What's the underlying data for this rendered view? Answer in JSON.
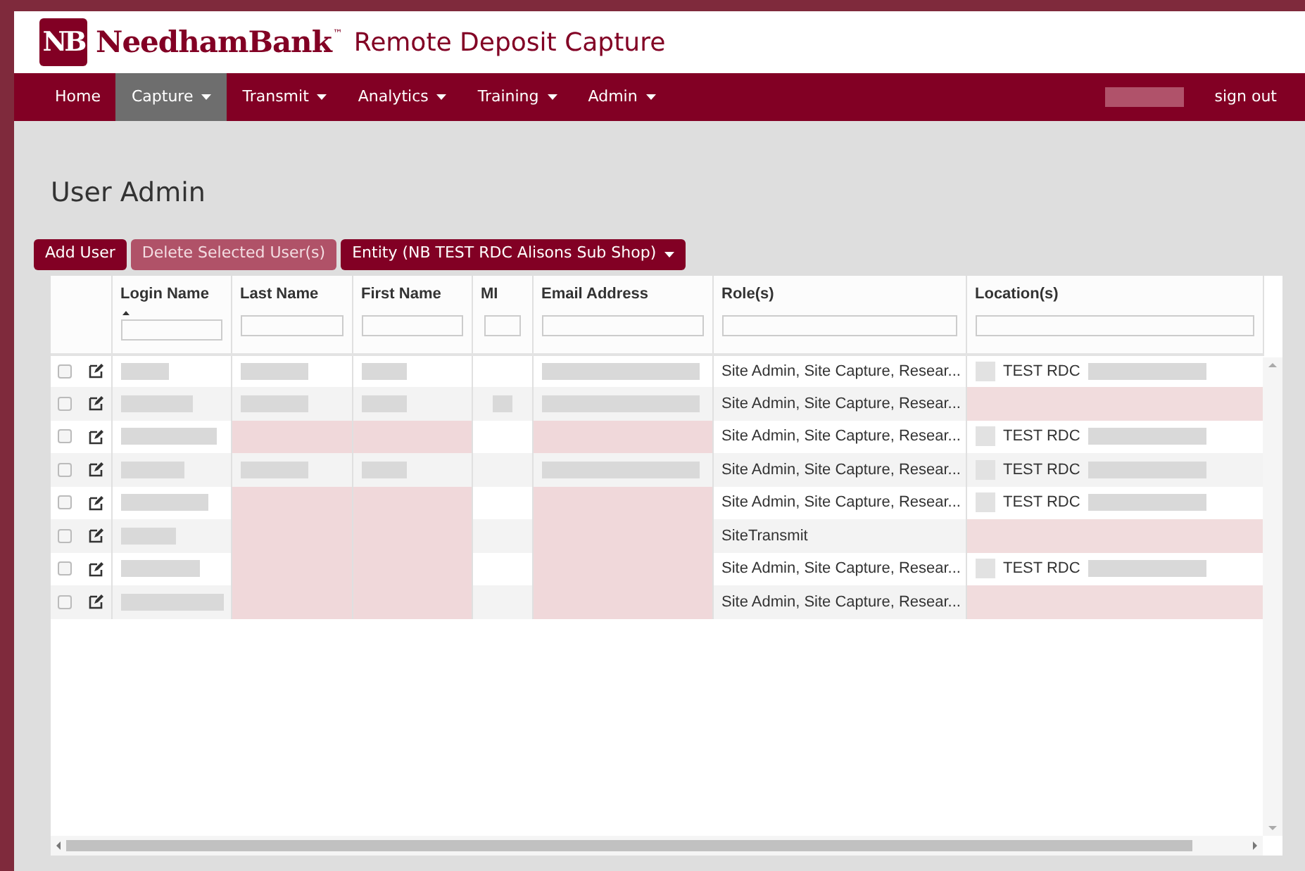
{
  "brand": {
    "mark": "NB",
    "name": "NeedhamBank",
    "trademark": "™",
    "product": "Remote Deposit Capture"
  },
  "nav": {
    "items": [
      {
        "label": "Home",
        "dropdown": false,
        "selected": false
      },
      {
        "label": "Capture",
        "dropdown": true,
        "selected": true
      },
      {
        "label": "Transmit",
        "dropdown": true,
        "selected": false
      },
      {
        "label": "Analytics",
        "dropdown": true,
        "selected": false
      },
      {
        "label": "Training",
        "dropdown": true,
        "selected": false
      },
      {
        "label": "Admin",
        "dropdown": true,
        "selected": false
      }
    ],
    "sign_out": "sign out"
  },
  "page_title": "User Admin",
  "toolbar": {
    "add": "Add User",
    "delete": {
      "label": "Delete Selected User(s)",
      "disabled": true
    },
    "entity": "Entity (NB TEST RDC Alisons Sub Shop)"
  },
  "table": {
    "columns": [
      {
        "label": "Login Name",
        "sorted": true
      },
      {
        "label": "Last Name",
        "sorted": false
      },
      {
        "label": "First Name",
        "sorted": false
      },
      {
        "label": "MI",
        "sorted": false
      },
      {
        "label": "Email Address",
        "sorted": false
      },
      {
        "label": "Role(s)",
        "sorted": false
      },
      {
        "label": "Location(s)",
        "sorted": false
      }
    ],
    "rows": [
      {
        "checked": false,
        "last_missing": false,
        "first_missing": false,
        "mi_filled": false,
        "email_missing": false,
        "roles": "Site Admin, Site Capture, Resear...",
        "location": "TEST RDC",
        "location_missing": false
      },
      {
        "checked": false,
        "last_missing": false,
        "first_missing": false,
        "mi_filled": true,
        "email_missing": false,
        "roles": "Site Admin, Site Capture, Resear...",
        "location_missing": true
      },
      {
        "checked": false,
        "last_missing": true,
        "first_missing": true,
        "mi_filled": false,
        "email_missing": true,
        "roles": "Site Admin, Site Capture, Resear...",
        "location": "TEST RDC",
        "location_missing": false
      },
      {
        "checked": false,
        "last_missing": false,
        "first_missing": false,
        "mi_filled": false,
        "email_missing": false,
        "roles": "Site Admin, Site Capture, Resear...",
        "location": "TEST RDC",
        "location_missing": false
      },
      {
        "checked": false,
        "last_missing": true,
        "first_missing": true,
        "mi_filled": false,
        "email_missing": true,
        "roles": "Site Admin, Site Capture, Resear...",
        "location": "TEST RDC",
        "location_missing": false
      },
      {
        "checked": false,
        "last_missing": true,
        "first_missing": true,
        "mi_filled": false,
        "email_missing": true,
        "roles": "SiteTransmit",
        "location_missing": true
      },
      {
        "checked": false,
        "last_missing": true,
        "first_missing": true,
        "mi_filled": false,
        "email_missing": true,
        "roles": "Site Admin, Site Capture, Resear...",
        "location": "TEST RDC",
        "location_missing": false
      },
      {
        "checked": false,
        "last_missing": true,
        "first_missing": true,
        "mi_filled": false,
        "email_missing": true,
        "roles": "Site Admin, Site Capture, Resear...",
        "location_missing": true
      }
    ]
  }
}
